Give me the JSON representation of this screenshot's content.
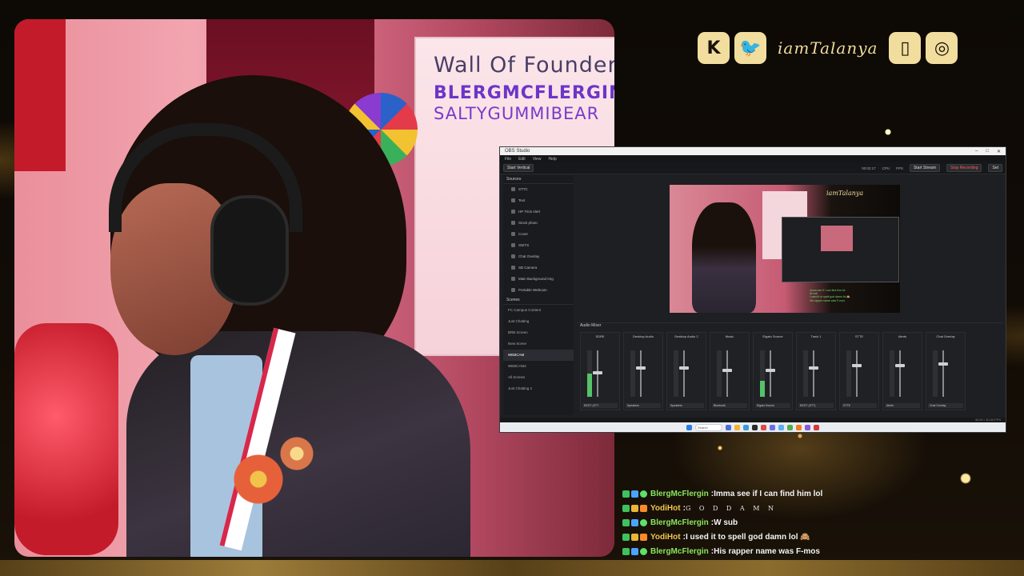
{
  "overlay": {
    "handle": "iamTalanya",
    "social_icons": [
      "kick-icon",
      "twitter-icon",
      "twitch-icon",
      "instagram-icon"
    ]
  },
  "whiteboard": {
    "title": "Wall Of Founders",
    "names": [
      "BLERGMCFLERGIN",
      "SALTYGUMMIBEAR"
    ]
  },
  "obs": {
    "title": "OBS Studio",
    "menu": [
      "File",
      "Edit",
      "View",
      "Help"
    ],
    "toolbar_left": "Start Vertical",
    "stats": [
      "00:02:17",
      "CPU",
      "FPS"
    ],
    "start_stream": "Start Stream",
    "stop_recording": "Stop Recording",
    "settings_short": "Set",
    "sources_header": "Sources",
    "sources": [
      "STTC",
      "Text",
      "HP Trick Alert",
      "Stock photo",
      "Cover",
      "SNITS",
      "Chat Overlay",
      "SB Camera",
      "Main Background Img",
      "Portable Webcam"
    ],
    "scenes_header": "Scenes",
    "scenes": [
      "FC Campus Content",
      "Just Chatting",
      "BRB Screen",
      "New Scene",
      "WEBCAM",
      "WEBCAM2",
      "All Scenes",
      "Just Chatting 2"
    ],
    "mixer_header": "Audio Mixer",
    "channels": [
      {
        "name": "SDRE",
        "device": "EEGT (STT",
        "level": 0.5,
        "fader": 0.55
      },
      {
        "name": "Desktop Audio",
        "device": "Speakers",
        "level": 0.0,
        "fader": 0.65
      },
      {
        "name": "Desktop Audio 2",
        "device": "Speakers",
        "level": 0.0,
        "fader": 0.65
      },
      {
        "name": "Music",
        "device": "Bluetooth",
        "level": 0.0,
        "fader": 0.6
      },
      {
        "name": "Elgato Source",
        "device": "Elgato Source",
        "level": 0.35,
        "fader": 0.6
      },
      {
        "name": "Track 1",
        "device": "EEGT (STT)",
        "level": 0.0,
        "fader": 0.65
      },
      {
        "name": "STTE",
        "device": "STTE",
        "level": 0.0,
        "fader": 0.7
      },
      {
        "name": "Alerts",
        "device": "Alerts",
        "level": 0.0,
        "fader": 0.7
      },
      {
        "name": "Chat Overlay",
        "device": "Chat Overlay",
        "level": 0.0,
        "fader": 0.75
      }
    ],
    "taskbar_search": "Search",
    "status": "30.00 / 30.00 FPS"
  },
  "chat": [
    {
      "user": "BlergMcFlergin",
      "user_color": "#8ae65e",
      "badges": [
        "b-green",
        "b-blue",
        "b-star"
      ],
      "text": "Imma see if I can find him lol",
      "spaced": false
    },
    {
      "user": "YodiHot",
      "user_color": "#f0c650",
      "badges": [
        "b-green",
        "b-gold",
        "b-orange"
      ],
      "text": "G O D D A M N",
      "spaced": true
    },
    {
      "user": "BlergMcFlergin",
      "user_color": "#8ae65e",
      "badges": [
        "b-green",
        "b-blue",
        "b-star"
      ],
      "text": "W sub",
      "spaced": false
    },
    {
      "user": "YodiHot",
      "user_color": "#f0c650",
      "badges": [
        "b-green",
        "b-gold",
        "b-orange"
      ],
      "text": "I used it to spell god damn lol 🙈",
      "spaced": false
    },
    {
      "user": "BlergMcFlergin",
      "user_color": "#8ae65e",
      "badges": [
        "b-green",
        "b-blue",
        "b-star"
      ],
      "text": "His rapper name was F-mos",
      "spaced": false
    }
  ]
}
